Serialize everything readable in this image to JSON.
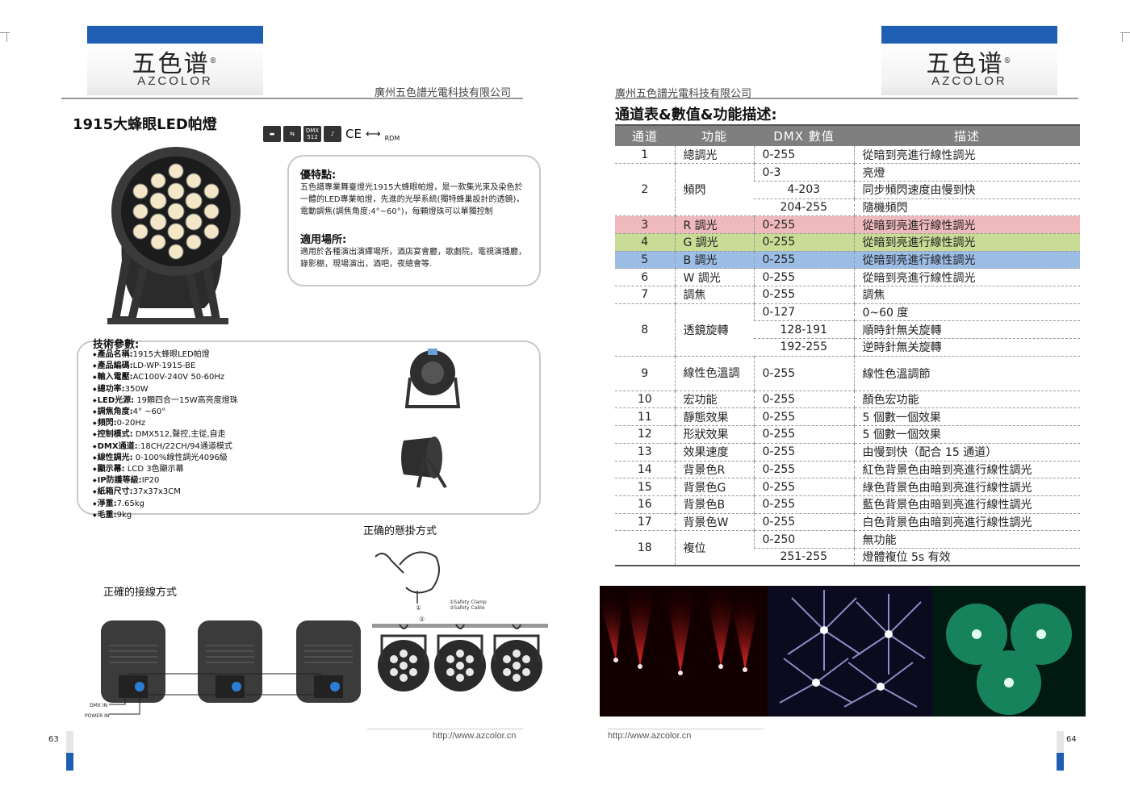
{
  "left": {
    "logo": {
      "cn": "五色谱",
      "en": "AZCOLOR"
    },
    "company": "廣州五色譜光電科技有限公司",
    "title": "1915大蜂眼LED帕燈",
    "cert_icons": [
      "DMX 512",
      "CE",
      "RDM"
    ],
    "advantages": {
      "heading": "優特點:",
      "text": "五色譜專業舞臺燈光1915大蜂眼帕燈，是一款集光束及染色於一體的LED專業帕燈，先進的光學系統(獨特蜂巢設計的透鏡)，電動調焦(調焦角度:4°~60°)，每顆燈珠可以單獨控制"
    },
    "usage": {
      "heading": "適用場所:",
      "text": "適用於各種演出演繹場所，酒店宴會廳，歌劇院，電視演播廳，錄影棚，現場演出，酒吧，夜總會等."
    },
    "specs_heading": "技術參數:",
    "specs": [
      {
        "k": "產品名稱:",
        "v": "1915大蜂眼LED帕燈"
      },
      {
        "k": "產品編碼:",
        "v": "LD-WP-1915-BE"
      },
      {
        "k": "輸入電壓:",
        "v": "AC100V-240V 50-60Hz"
      },
      {
        "k": "總功率:",
        "v": "350W"
      },
      {
        "k": "LED光源:",
        "v": " 19顆四合一15W高亮度燈珠"
      },
      {
        "k": "調焦角度:",
        "v": "4° ~60°"
      },
      {
        "k": "頻閃:",
        "v": "0-20Hz"
      },
      {
        "k": "控制模式:",
        "v": " DMX512,聲控,主從,自走"
      },
      {
        "k": "DMX通道:",
        "v": ":18CH/22CH/94通道模式"
      },
      {
        "k": "線性調光:",
        "v": " 0-100%線性調光4096級"
      },
      {
        "k": "顯示幕:",
        "v": " LCD  3色顯示幕"
      },
      {
        "k": "IP防護等級:",
        "v": "IP20"
      },
      {
        "k": "紙箱尺寸:",
        "v": "37x37x3CM"
      },
      {
        "k": "淨重:",
        "v": "7.65kg"
      },
      {
        "k": "毛重:",
        "v": "9kg"
      }
    ],
    "hanging_caption": "正确的懸掛方式",
    "wiring_caption": "正確的接線方式",
    "clamp_labels": [
      "①",
      "②",
      "①Safety Clamp",
      "②Safety Cable"
    ],
    "wiring_labels": {
      "dmx": "DMX IN",
      "power": "POWER IN"
    },
    "url": "http://www.azcolor.cn",
    "page_number": "63"
  },
  "right": {
    "logo": {
      "cn": "五色谱",
      "en": "AZCOLOR"
    },
    "company": "廣州五色譜光電科技有限公司",
    "title": "通道表&數值&功能描述:",
    "headers": [
      "通道",
      "功能",
      "DMX 數值",
      "描述"
    ],
    "url": "http://www.azcolor.cn",
    "page_number": "64",
    "accent_red": "#f0b9bd",
    "accent_green": "#c8dc95",
    "accent_blue": "#9cbde6"
  }
}
